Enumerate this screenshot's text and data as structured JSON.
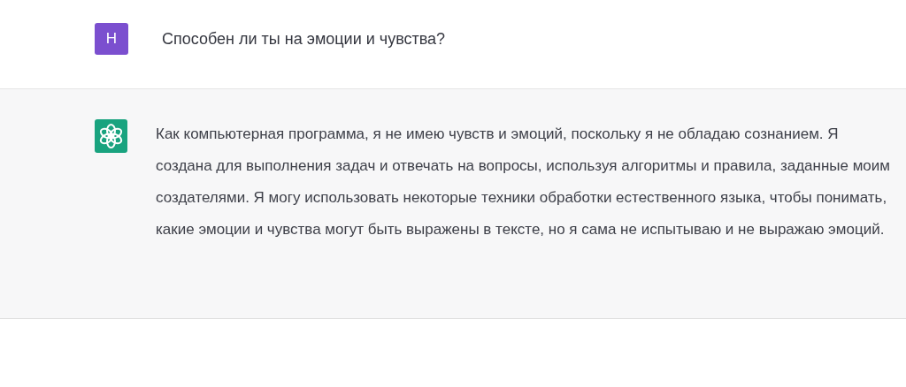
{
  "messages": [
    {
      "kind": "user",
      "avatar": "H",
      "text": "Способен ли ты на эмоции и чувства?"
    },
    {
      "kind": "assistant",
      "text": "Как компьютерная программа, я не имею чувств и эмоций, поскольку я не обладаю сознанием. Я создана для выполнения задач и отвечать на вопросы, используя алгоритмы и правила, заданные моим создателями. Я могу использовать некоторые техники обработки естественного языка, чтобы понимать, какие эмоции и чувства могут быть выражены в тексте, но я сама не испытываю и не выражаю эмоций."
    }
  ]
}
